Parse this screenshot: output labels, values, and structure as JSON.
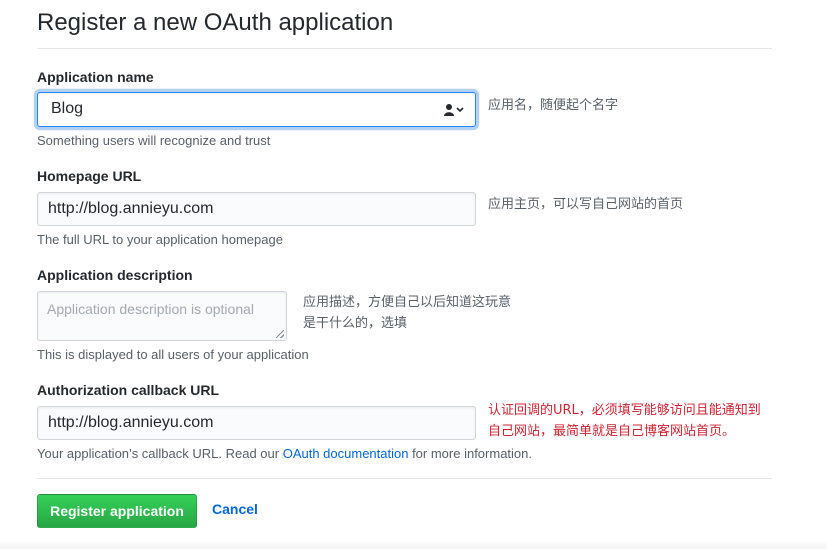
{
  "header": {
    "title": "Register a new OAuth application"
  },
  "fields": {
    "app_name": {
      "label": "Application name",
      "value": "Blog",
      "hint": "Something users will recognize and trust",
      "note": "应用名，随便起个名字"
    },
    "homepage": {
      "label": "Homepage URL",
      "value": "http://blog.annieyu.com",
      "hint": "The full URL to your application homepage",
      "note": "应用主页，可以写自己网站的首页"
    },
    "description": {
      "label": "Application description",
      "placeholder": "Application description is optional",
      "hint": "This is displayed to all users of your application",
      "note_line1": "应用描述，方便自己以后知道这玩意",
      "note_line2": "是干什么的，选填"
    },
    "callback": {
      "label": "Authorization callback URL",
      "value": "http://blog.annieyu.com",
      "hint_prefix": "Your application’s callback URL. Read our ",
      "hint_link": "OAuth documentation",
      "hint_suffix": " for more information.",
      "note_line1": "认证回调的URL，必须填写能够访问且能通知到",
      "note_line2": "自己网站，最简单就是自己博客网站首页。"
    }
  },
  "actions": {
    "register_label": "Register application",
    "cancel_label": "Cancel"
  },
  "icons": {
    "autofill": "user-autofill-icon",
    "dropdown": "chevron-down-icon"
  },
  "colors": {
    "primary_button": "#28a745",
    "link": "#0366d6",
    "focus": "#2188ff",
    "annotation_red": "#cb2431"
  }
}
